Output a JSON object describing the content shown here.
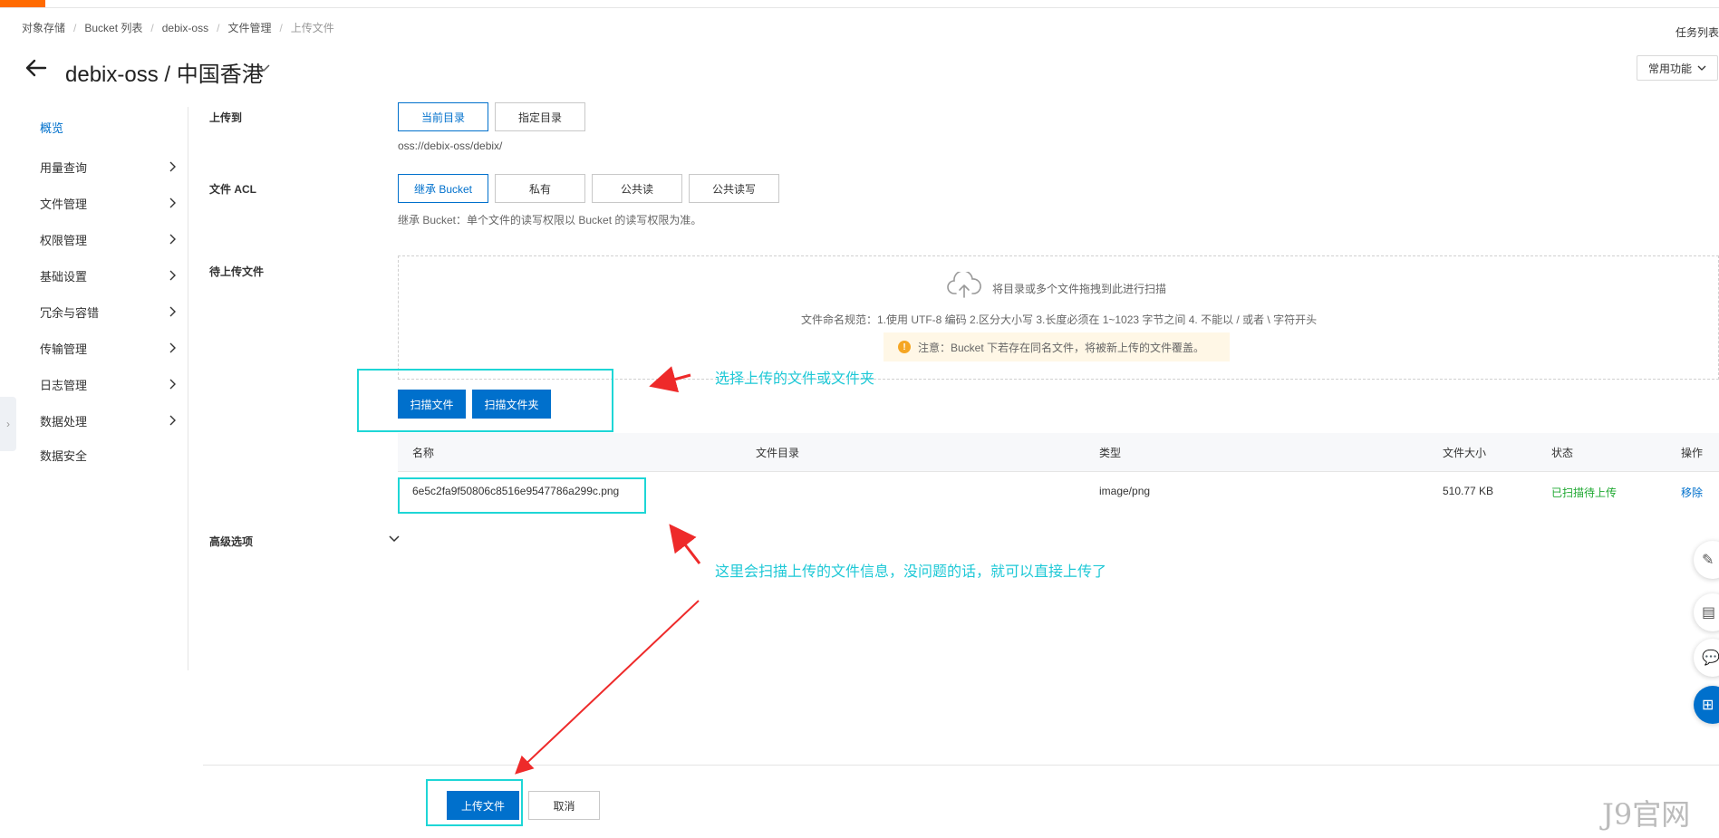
{
  "breadcrumb": [
    "对象存储",
    "Bucket 列表",
    "debix-oss",
    "文件管理",
    "上传文件"
  ],
  "header": {
    "task_list": "任务列表",
    "title": "debix-oss / 中国香港",
    "common_functions": "常用功能"
  },
  "sidebar": {
    "items": [
      {
        "label": "概览"
      },
      {
        "label": "用量查询"
      },
      {
        "label": "文件管理"
      },
      {
        "label": "权限管理"
      },
      {
        "label": "基础设置"
      },
      {
        "label": "冗余与容错"
      },
      {
        "label": "传输管理"
      },
      {
        "label": "日志管理"
      },
      {
        "label": "数据处理"
      },
      {
        "label": "数据安全"
      }
    ]
  },
  "form": {
    "upload_to": {
      "label": "上传到",
      "options": [
        "当前目录",
        "指定目录"
      ],
      "selected": "当前目录",
      "path": "oss://debix-oss/debix/"
    },
    "acl": {
      "label": "文件 ACL",
      "options": [
        "继承 Bucket",
        "私有",
        "公共读",
        "公共读写"
      ],
      "selected": "继承 Bucket",
      "hint": "继承 Bucket：单个文件的读写权限以 Bucket 的读写权限为准。"
    },
    "files": {
      "label": "待上传文件",
      "drop_text": "将目录或多个文件拖拽到此进行扫描",
      "naming_rule": "文件命名规范：1.使用 UTF-8 编码 2.区分大小写 3.长度必须在 1~1023 字节之间 4. 不能以 / 或者 \\ 字符开头",
      "notice": "注意：Bucket 下若存在同名文件，将被新上传的文件覆盖。",
      "scan_file": "扫描文件",
      "scan_folder": "扫描文件夹"
    },
    "advanced": {
      "label": "高级选项"
    }
  },
  "table": {
    "columns": [
      "名称",
      "文件目录",
      "类型",
      "文件大小",
      "状态",
      "操作"
    ],
    "rows": [
      {
        "name": "6e5c2fa9f50806c8516e9547786a299c.png",
        "dir": "",
        "type": "image/png",
        "size": "510.77 KB",
        "status": "已扫描待上传",
        "action": "移除"
      }
    ]
  },
  "footer": {
    "upload": "上传文件",
    "cancel": "取消"
  },
  "annotations": {
    "select_hint": "选择上传的文件或文件夹",
    "scan_hint": "这里会扫描上传的文件信息，没问题的话，就可以直接上传了"
  },
  "watermark": "J9官网",
  "colors": {
    "primary": "#0070cc",
    "accent": "#ff6a00",
    "annotation": "#1ed6d6",
    "arrow": "#ee2a2a",
    "status_ok": "#1ea830"
  }
}
